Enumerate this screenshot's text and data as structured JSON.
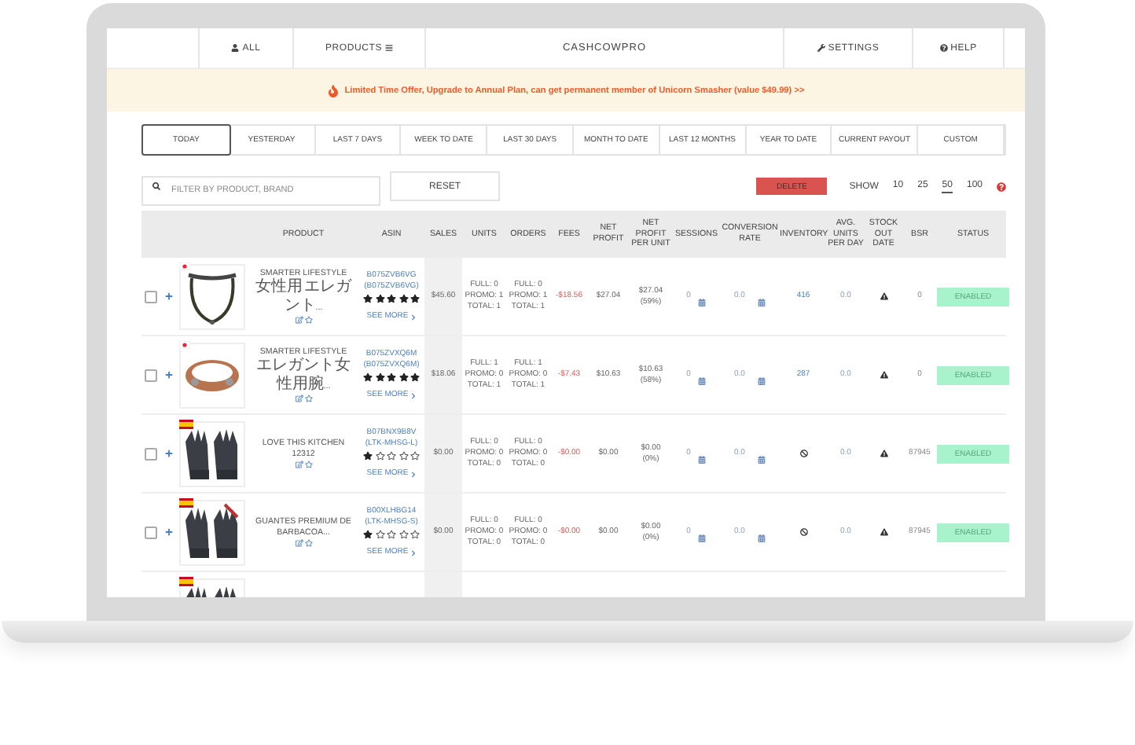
{
  "nav": {
    "items": [
      {
        "kind": "user",
        "label": "ALL"
      },
      {
        "kind": "menu",
        "label": "PRODUCTS"
      },
      {
        "kind": "brand",
        "label": "CASHCOWPRO"
      },
      {
        "kind": "wrench",
        "label": "SETTINGS"
      },
      {
        "kind": "help",
        "label": "HELP"
      }
    ]
  },
  "banner": {
    "text": "Limited Time Offer, Upgrade to Annual Plan, can get permanent member of Unicorn Smasher (value $49.99) >>"
  },
  "date_tabs": [
    {
      "label": "TODAY",
      "selected": true
    },
    {
      "label": "YESTERDAY",
      "selected": false
    },
    {
      "label": "LAST 7 DAYS",
      "selected": false
    },
    {
      "label": "WEEK TO DATE",
      "selected": false
    },
    {
      "label": "LAST 30 DAYS",
      "selected": false
    },
    {
      "label": "MONTH TO DATE",
      "selected": false
    },
    {
      "label": "LAST 12 MONTHS",
      "selected": false
    },
    {
      "label": "YEAR TO DATE",
      "selected": false
    },
    {
      "label": "CURRENT PAYOUT",
      "selected": false
    },
    {
      "label": "CUSTOM",
      "selected": false
    }
  ],
  "filter": {
    "placeholder": "FILTER BY PRODUCT, BRAND",
    "reset": "RESET",
    "delete": "DELETE",
    "show_label": "SHOW",
    "page_sizes": [
      {
        "label": "10",
        "selected": false
      },
      {
        "label": "25",
        "selected": false
      },
      {
        "label": "50",
        "selected": true
      },
      {
        "label": "100",
        "selected": false
      }
    ]
  },
  "table": {
    "columns": [
      "PRODUCT",
      "ASIN",
      "SALES",
      "UNITS",
      "ORDERS",
      "FEES",
      "NET PROFIT",
      "NET PROFIT PER UNIT",
      "SESSIONS",
      "CONVERSION RATE",
      "INVENTORY",
      "AVG. UNITS PER DAY",
      "STOCK OUT DATE",
      "BSR",
      "STATUS"
    ],
    "rows": [
      {
        "kind": "full",
        "checked": false,
        "flag": {
          "kind": "jp"
        },
        "product": "SMARTER LIFESTYLE 女性用 エレガント...",
        "asin": "B075ZVB6VG",
        "sku": "(B075ZVB6VG)",
        "stars": 5,
        "see_more": "SEE MORE",
        "sales": "$45.60",
        "units": [
          "FULL: 0",
          "PROMO: 1",
          "TOTAL: 1"
        ],
        "orders": [
          "FULL: 0",
          "PROMO: 1",
          "TOTAL: 1"
        ],
        "fees": "-$18.56",
        "net_profit": "$27.04",
        "npu": [
          "$27.04",
          "(59%)"
        ],
        "sessions": "0",
        "conversion": "0.0",
        "inventory": {
          "kind": "count",
          "text": "416"
        },
        "avg": "0.0",
        "bsr": "0",
        "status": "ENABLED",
        "enabled": true
      },
      {
        "kind": "full",
        "checked": false,
        "flag": {
          "kind": "jp"
        },
        "product": "SMARTER LIFESTYLE エレガント女性用腕...",
        "asin": "B075ZVXQ6M",
        "sku": "(B075ZVXQ6M)",
        "stars": 5,
        "see_more": "SEE MORE",
        "sales": "$18.06",
        "units": [
          "FULL: 1",
          "PROMO: 0",
          "TOTAL: 1"
        ],
        "orders": [
          "FULL: 1",
          "PROMO: 0",
          "TOTAL: 1"
        ],
        "fees": "-$7.43",
        "net_profit": "$10.63",
        "npu": [
          "$10.63",
          "(58%)"
        ],
        "sessions": "0",
        "conversion": "0.0",
        "inventory": {
          "kind": "count",
          "text": "287"
        },
        "avg": "0.0",
        "bsr": "0",
        "status": "ENABLED",
        "enabled": true
      },
      {
        "kind": "full",
        "checked": false,
        "flag": {
          "kind": "es"
        },
        "product": "LOVE THIS KITCHEN 12312",
        "asin": "B07BNX9B8V",
        "sku": "(LTK-MHSG-L)",
        "stars": 1,
        "see_more": "SEE MORE",
        "sales": "$0.00",
        "units": [
          "FULL: 0",
          "PROMO: 0",
          "TOTAL: 0"
        ],
        "orders": [
          "FULL: 0",
          "PROMO: 0",
          "TOTAL: 0"
        ],
        "fees": "-$0.00",
        "net_profit": "$0.00",
        "npu": [
          "$0.00",
          "(0%)"
        ],
        "sessions": "0",
        "conversion": "0.0",
        "inventory": {
          "kind": "none"
        },
        "avg": "0.0",
        "bsr": "87945",
        "status": "ENABLED",
        "enabled": true
      },
      {
        "kind": "full",
        "checked": false,
        "flag": {
          "kind": "es"
        },
        "product": "GUANTES PREMIUM DE BARBACOA...",
        "asin": "B00XLHBG14",
        "sku": "(LTK-MHSG-S)",
        "stars": 1,
        "see_more": "SEE MORE",
        "sales": "$0.00",
        "units": [
          "FULL: 0",
          "PROMO: 0",
          "TOTAL: 0"
        ],
        "orders": [
          "FULL: 0",
          "PROMO: 0",
          "TOTAL: 0"
        ],
        "fees": "-$0.00",
        "net_profit": "$0.00",
        "npu": [
          "$0.00",
          "(0%)"
        ],
        "sessions": "0",
        "conversion": "0.0",
        "inventory": {
          "kind": "none"
        },
        "avg": "0.0",
        "bsr": "87945",
        "status": "ENABLED",
        "enabled": true
      },
      {
        "kind": "partial",
        "flag": {
          "kind": "es"
        }
      }
    ]
  }
}
